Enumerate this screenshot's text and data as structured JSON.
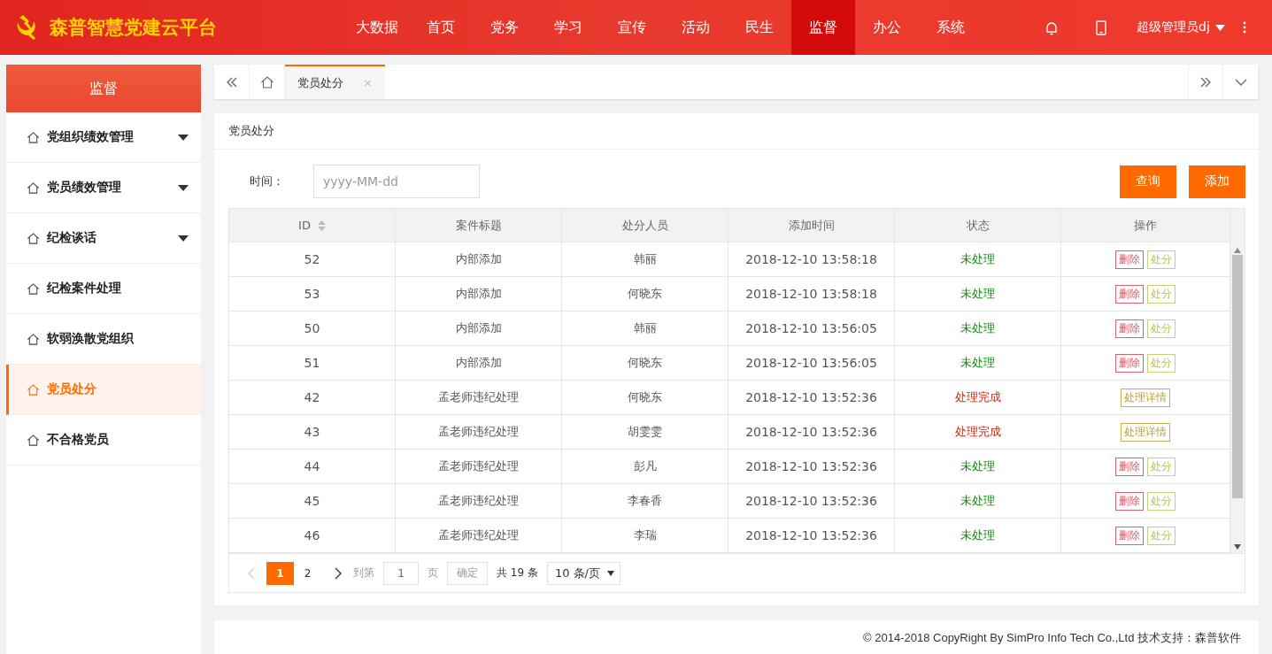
{
  "header": {
    "brand": "森普智慧党建云平台",
    "nav": [
      {
        "label": "大数据",
        "selected": false
      },
      {
        "label": "首页",
        "selected": false
      },
      {
        "label": "党务",
        "selected": false
      },
      {
        "label": "学习",
        "selected": false
      },
      {
        "label": "宣传",
        "selected": false
      },
      {
        "label": "活动",
        "selected": false
      },
      {
        "label": "民生",
        "selected": false
      },
      {
        "label": "监督",
        "selected": true
      },
      {
        "label": "办公",
        "selected": false
      },
      {
        "label": "系统",
        "selected": false
      }
    ],
    "user": "超级管理员dj"
  },
  "sidebar": {
    "title": "监督",
    "items": [
      {
        "label": "党组织绩效管理",
        "expandable": true,
        "selected": false
      },
      {
        "label": "党员绩效管理",
        "expandable": true,
        "selected": false
      },
      {
        "label": "纪检谈话",
        "expandable": true,
        "selected": false
      },
      {
        "label": "纪检案件处理",
        "expandable": false,
        "selected": false
      },
      {
        "label": "软弱涣散党组织",
        "expandable": false,
        "selected": false
      },
      {
        "label": "党员处分",
        "expandable": false,
        "selected": true
      },
      {
        "label": "不合格党员",
        "expandable": false,
        "selected": false
      }
    ]
  },
  "tabs": [
    {
      "label": "党员处分",
      "close": "×",
      "selected": true
    }
  ],
  "panel": {
    "title": "党员处分",
    "filter_label": "时间：",
    "date_placeholder": "yyyy-MM-dd",
    "buttons": [
      "查询",
      "添加"
    ]
  },
  "table": {
    "columns": [
      "ID",
      "案件标题",
      "处分人员",
      "添加时间",
      "状态",
      "操作"
    ],
    "rows": [
      {
        "id": "52",
        "title": "内部添加",
        "person": "韩丽",
        "time": "2018-12-10 13:58:18",
        "status": "未处理",
        "completed": false,
        "actions": [
          {
            "kind": "delete",
            "label": "删除"
          },
          {
            "kind": "punish",
            "label": "处分"
          }
        ]
      },
      {
        "id": "53",
        "title": "内部添加",
        "person": "何晓东",
        "time": "2018-12-10 13:58:18",
        "status": "未处理",
        "completed": false,
        "actions": [
          {
            "kind": "delete",
            "label": "删除"
          },
          {
            "kind": "punish",
            "label": "处分"
          }
        ]
      },
      {
        "id": "50",
        "title": "内部添加",
        "person": "韩丽",
        "time": "2018-12-10 13:56:05",
        "status": "未处理",
        "completed": false,
        "actions": [
          {
            "kind": "delete",
            "label": "删除"
          },
          {
            "kind": "punish",
            "label": "处分"
          }
        ]
      },
      {
        "id": "51",
        "title": "内部添加",
        "person": "何晓东",
        "time": "2018-12-10 13:56:05",
        "status": "未处理",
        "completed": false,
        "actions": [
          {
            "kind": "delete",
            "label": "删除"
          },
          {
            "kind": "punish",
            "label": "处分"
          }
        ]
      },
      {
        "id": "42",
        "title": "孟老师违纪处理",
        "person": "何晓东",
        "time": "2018-12-10 13:52:36",
        "status": "处理完成",
        "completed": true,
        "actions": [
          {
            "kind": "detail",
            "label": "处理详情"
          }
        ]
      },
      {
        "id": "43",
        "title": "孟老师违纪处理",
        "person": "胡雯雯",
        "time": "2018-12-10 13:52:36",
        "status": "处理完成",
        "completed": true,
        "actions": [
          {
            "kind": "detail",
            "label": "处理详情"
          }
        ]
      },
      {
        "id": "44",
        "title": "孟老师违纪处理",
        "person": "彭凡",
        "time": "2018-12-10 13:52:36",
        "status": "未处理",
        "completed": false,
        "actions": [
          {
            "kind": "delete",
            "label": "删除"
          },
          {
            "kind": "punish",
            "label": "处分"
          }
        ]
      },
      {
        "id": "45",
        "title": "孟老师违纪处理",
        "person": "李春香",
        "time": "2018-12-10 13:52:36",
        "status": "未处理",
        "completed": false,
        "actions": [
          {
            "kind": "delete",
            "label": "删除"
          },
          {
            "kind": "punish",
            "label": "处分"
          }
        ]
      },
      {
        "id": "46",
        "title": "孟老师违纪处理",
        "person": "李瑞",
        "time": "2018-12-10 13:52:36",
        "status": "未处理",
        "completed": false,
        "actions": [
          {
            "kind": "delete",
            "label": "删除"
          },
          {
            "kind": "punish",
            "label": "处分"
          }
        ]
      }
    ]
  },
  "pager": {
    "pages": [
      {
        "label": "1",
        "selected": true
      },
      {
        "label": "2",
        "selected": false
      }
    ],
    "goto_label": "到第",
    "goto_value": "1",
    "page_unit": "页",
    "confirm": "确定",
    "total": "共 19 条",
    "page_size": "10 条/页"
  },
  "footer": "© 2014-2018 CopyRight By SimPro Info Tech Co.,Ltd 技术支持：森普软件"
}
